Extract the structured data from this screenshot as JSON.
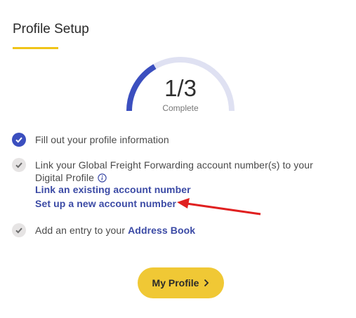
{
  "page": {
    "title": "Profile Setup"
  },
  "progress": {
    "value_text": "1/3",
    "label": "Complete",
    "completed": 1,
    "total": 3,
    "fraction": 0.333,
    "colors": {
      "filled": "#3b4fbf",
      "track": "#dfe1f2"
    }
  },
  "steps": [
    {
      "text": "Fill out your profile information",
      "status": "complete"
    },
    {
      "text": "Link your Global Freight Forwarding account number(s) to your Digital Profile",
      "status": "incomplete",
      "links": [
        "Link an existing account number",
        "Set up a new account number"
      ]
    },
    {
      "text_prefix": "Add an entry to your ",
      "link": "Address Book",
      "status": "incomplete"
    }
  ],
  "step2_line1": "Link your Global Freight Forwarding account number(s) to your",
  "step2_line2": "Digital Profile",
  "annotation": {
    "color": "#e02020"
  },
  "button": {
    "label": "My Profile",
    "color": "#f0c835"
  }
}
